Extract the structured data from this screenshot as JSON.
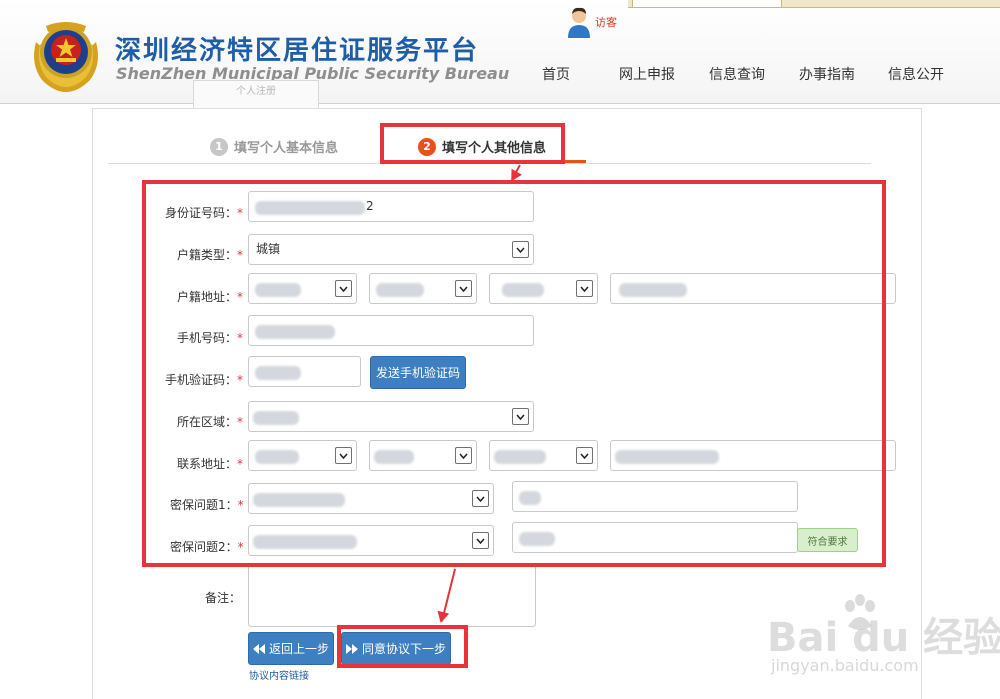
{
  "header": {
    "title": "深圳经济特区居住证服务平台",
    "subtitle": "ShenZhen Municipal Public Security Bureau",
    "visitor_label": "访客",
    "nav": [
      "首页",
      "网上申报",
      "信息查询",
      "办事指南",
      "信息公开"
    ],
    "registration_tab": "个人注册"
  },
  "steps": {
    "step1": {
      "number": "1",
      "label": "填写个人基本信息"
    },
    "step2": {
      "number": "2",
      "label": "填写个人其他信息"
    }
  },
  "form": {
    "required_mark": "*",
    "id_number": {
      "label": "身份证号码：",
      "value": "2"
    },
    "household_type": {
      "label": "户籍类型：",
      "value": "城镇"
    },
    "household_address": {
      "label": "户籍地址："
    },
    "phone": {
      "label": "手机号码："
    },
    "phone_code": {
      "label": "手机验证码："
    },
    "send_code_button": "发送手机验证码",
    "region": {
      "label": "所在区域："
    },
    "contact_address": {
      "label": "联系地址："
    },
    "security_q1": {
      "label": "密保问题1："
    },
    "security_q2": {
      "label": "密保问题2："
    },
    "q2_valid_badge": "符合要求",
    "remarks": {
      "label": "备注："
    }
  },
  "buttons": {
    "back": "返回上一步",
    "next": "同意协议下一步"
  },
  "agreement_link": "协议内容链接",
  "watermark": {
    "brand": "Bai du 经验",
    "url": "jingyan.baidu.com"
  },
  "colors": {
    "brand_blue": "#1e5da8",
    "button_blue": "#3d7fc0",
    "accent_orange": "#e8501c",
    "annotation_red": "#e8323c"
  }
}
